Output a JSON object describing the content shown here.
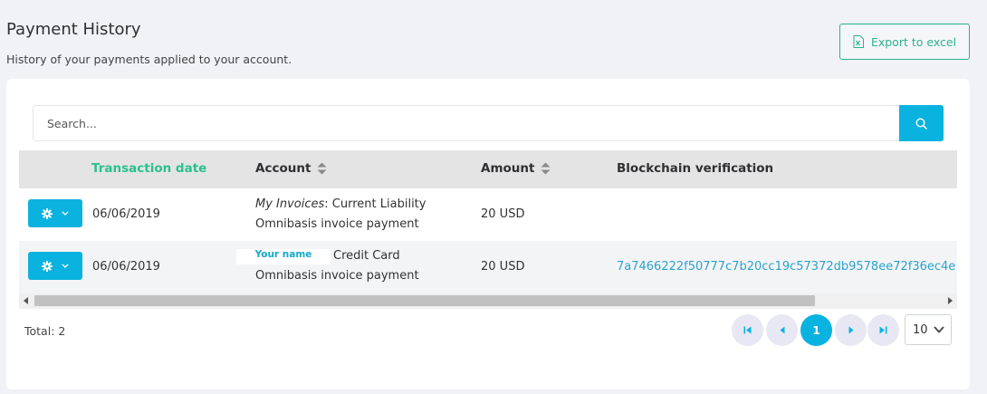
{
  "header": {
    "title": "Payment History",
    "subtitle": "History of your payments applied to your account.",
    "export_label": "Export to excel"
  },
  "search": {
    "placeholder": "Search..."
  },
  "table": {
    "columns": {
      "date": "Transaction date",
      "account": "Account",
      "amount": "Amount",
      "blockchain": "Blockchain verification"
    },
    "rows": [
      {
        "date": "06/06/2019",
        "account_italic": "My Invoices",
        "account_rest": ": Current Liability",
        "account_line2": "Omnibasis invoice payment",
        "amount": "20 USD",
        "hash": ""
      },
      {
        "date": "06/06/2019",
        "account_name_overlay": "Your name",
        "account_rest": "Credit Card",
        "account_line2": "Omnibasis invoice payment",
        "amount": "20 USD",
        "hash": "7a7466222f50777c7b20cc19c57372db9578ee72f36ec4e"
      }
    ]
  },
  "footer": {
    "total": "Total: 2",
    "current_page": "1",
    "per_page": "10"
  },
  "colors": {
    "accent": "#0ab2e0",
    "green": "#2bb38a",
    "link": "#2aa3cc"
  }
}
